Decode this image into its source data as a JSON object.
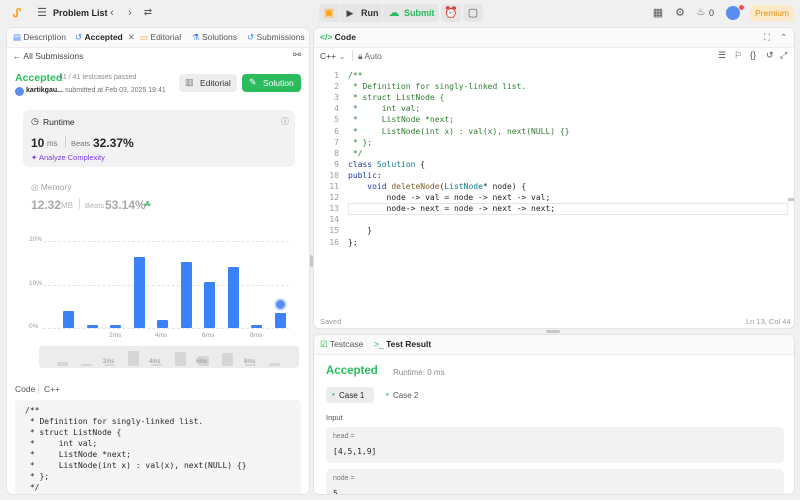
{
  "topbar": {
    "logo_icon": "leetcode-logo",
    "list_icon": "list-icon",
    "title": "Problem List",
    "prev_icon": "chevron-left-icon",
    "next_icon": "chevron-right-icon",
    "shuffle_icon": "shuffle-icon",
    "debug_icon": "debug-icon",
    "run_label": "Run",
    "submit_label": "Submit",
    "timer_icon": "alarm-icon",
    "note_icon": "note-icon",
    "layout_icon": "layout-grid-icon",
    "settings_icon": "gear-icon",
    "streak_icon": "fire-icon",
    "streak_count": "0",
    "avatar_icon": "avatar",
    "premium_label": "Premium",
    "accent": "#2cbb5d",
    "premium_color": "#ffa116"
  },
  "left_tabs": [
    {
      "label": "Description",
      "icon": "description-icon"
    },
    {
      "label": "Accepted",
      "icon": "history-icon"
    },
    {
      "label": "Editorial",
      "icon": "editorial-icon"
    },
    {
      "label": "Solutions",
      "icon": "flask-icon"
    },
    {
      "label": "Submissions",
      "icon": "history-icon"
    }
  ],
  "submission": {
    "back_label": "All Submissions",
    "status": "Accepted",
    "testcases": "41 / 41 testcases passed",
    "user": "kartikgau...",
    "submitted": "submitted at Feb 03, 2025 19:41",
    "editorial_btn": "Editorial",
    "solution_btn": "Solution",
    "status_color": "#2cbb5d"
  },
  "runtime": {
    "label": "Runtime",
    "value": "10",
    "unit": "ms",
    "beats_label": "Beats",
    "beats": "32.37%",
    "analyze": "Analyze Complexity"
  },
  "memory": {
    "label": "Memory",
    "value": "12.32",
    "unit": "MB",
    "beats_label": "Beats",
    "beats": "53.14%"
  },
  "chart_data": {
    "type": "bar",
    "y_ticks": [
      "20%",
      "10%",
      "0%"
    ],
    "ylim": [
      0,
      20
    ],
    "x_ticks": [
      "2ms",
      "4ms",
      "6ms",
      "8ms"
    ],
    "values": [
      4,
      0.7,
      0.6,
      16.3,
      1.8,
      15.2,
      10.6,
      14.1,
      0.7,
      3.4
    ],
    "highlight_index": 9,
    "color": "#3b82f6"
  },
  "mini_chart": {
    "x_ticks": [
      "2ms",
      "4ms",
      "6ms",
      "8ms"
    ],
    "values": [
      4,
      0.7,
      0.6,
      16.3,
      1.8,
      15.2,
      10.6,
      14.1,
      0.7,
      3.4
    ]
  },
  "left_code": {
    "label": "Code",
    "lang": "C++",
    "lines": [
      "/**",
      " * Definition for singly-linked list.",
      " * struct ListNode {",
      " *     int val;",
      " *     ListNode *next;",
      " *     ListNode(int x) : val(x), next(NULL) {}",
      " * };",
      " */"
    ]
  },
  "editor": {
    "title": "Code",
    "lang": "C++",
    "auto": "Auto",
    "saved": "Saved",
    "cursor": "Ln 13, Col 44",
    "line_numbers": [
      "1",
      "2",
      "3",
      "4",
      "5",
      "6",
      "7",
      "8",
      "9",
      "10",
      "11",
      "12",
      "13",
      "14",
      "15",
      "16"
    ],
    "lines": [
      "/**",
      " * Definition for singly-linked list.",
      " * struct ListNode {",
      " *     int val;",
      " *     ListNode *next;",
      " *     ListNode(int x) : val(x), next(NULL) {}",
      " * };",
      " */",
      "class Solution {",
      "public:",
      "    void deleteNode(ListNode* node) {",
      "        node -> val = node -> next -> val;",
      "        node-> next = node -> next -> next;",
      "",
      "    }",
      "};"
    ]
  },
  "result": {
    "tab_testcase": "Testcase",
    "tab_result": "Test Result",
    "status": "Accepted",
    "runtime": "Runtime: 0 ms",
    "case1": "Case 1",
    "case2": "Case 2",
    "input_label": "Input",
    "head_label": "head =",
    "head_value": "[4,5,1,9]",
    "node_label": "node =",
    "node_value": "5"
  }
}
